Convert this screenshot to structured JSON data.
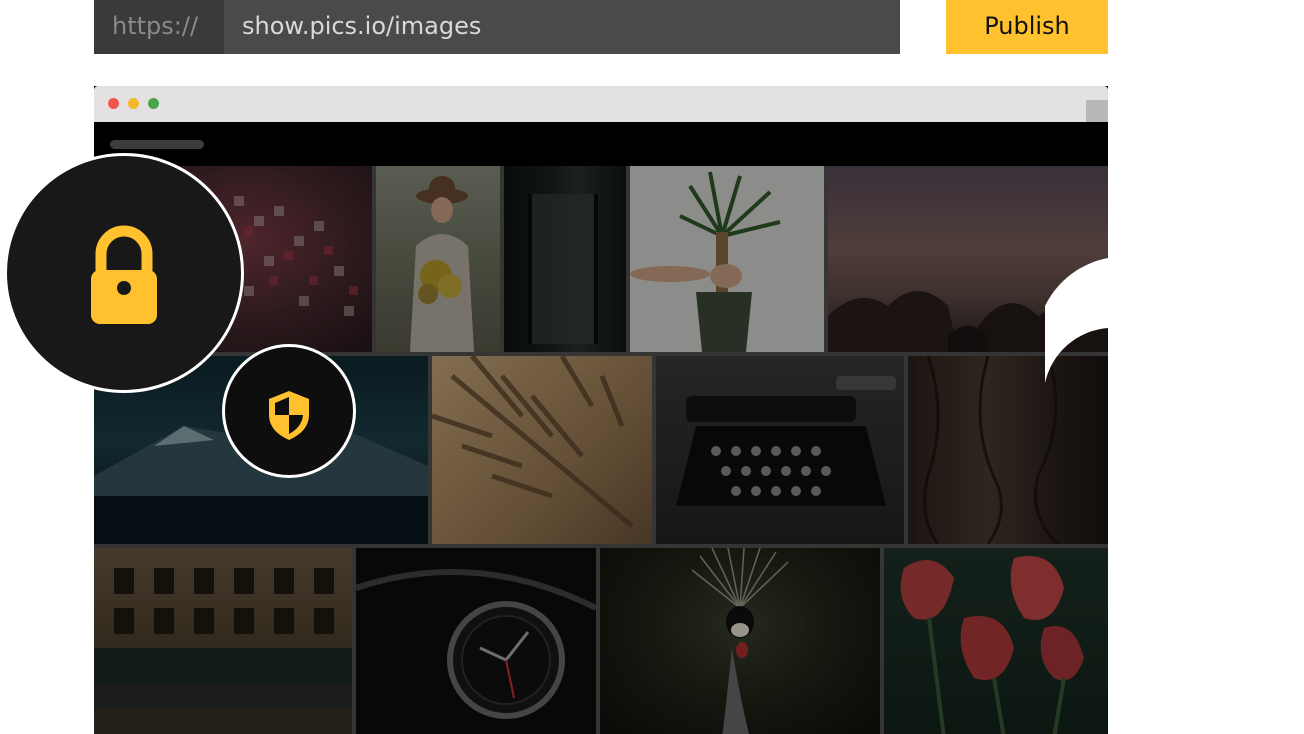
{
  "url_bar": {
    "prefix": "https://",
    "address": "show.pics.io/images",
    "publish_label": "Publish"
  },
  "colors": {
    "accent": "#ffc12e",
    "url_bar_bg": "#4a4a4a",
    "url_prefix_bg": "#3a3a3a",
    "browser_chrome": "#e3e1e2",
    "window_dot_red": "#f0564b",
    "window_dot_yellow": "#f4b92a",
    "window_dot_green": "#4aa54a"
  },
  "icons": {
    "lock": "lock-icon",
    "shield": "shield-icon"
  },
  "gallery": {
    "images": [
      "letter-beads",
      "woman-with-flowers",
      "city-window",
      "hand-holding-plant",
      "rocky-seashore",
      "snowy-mountain",
      "palm-shadow",
      "typewriter",
      "tree-bark",
      "paris-storefront",
      "car-dashboard-clock",
      "crowned-crane",
      "red-tulips"
    ]
  }
}
